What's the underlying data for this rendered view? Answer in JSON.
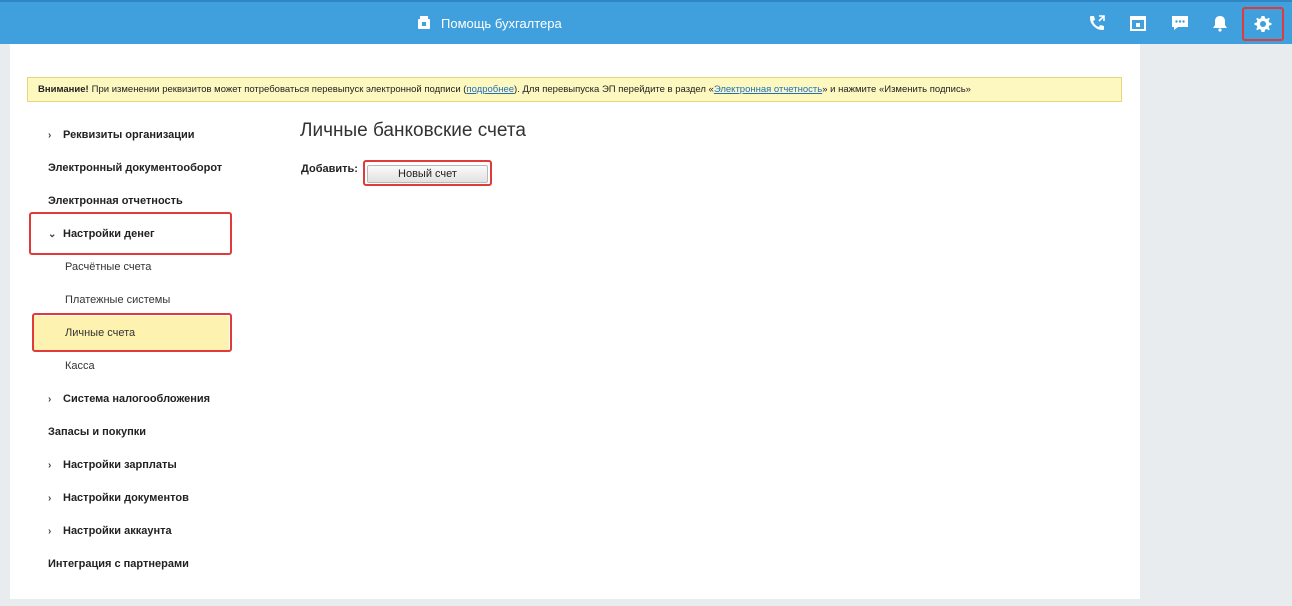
{
  "header": {
    "title": "Помощь бухгалтера",
    "icons": [
      "phone-icon",
      "calendar-icon",
      "chat-icon",
      "bell-icon",
      "gear-icon"
    ]
  },
  "notice": {
    "bold": "Внимание!",
    "text1": "При изменении реквизитов может потребоваться перевыпуск электронной подписи (",
    "link1": "подробнее",
    "text2": "). Для перевыпуска ЭП перейдите в раздел «",
    "link2": "Электронная отчетность",
    "text3": "» и нажмите «Изменить подпись»"
  },
  "sidebar": {
    "items": [
      {
        "label": "Реквизиты организации",
        "arrow": "›"
      },
      {
        "label": "Электронный документооборот"
      },
      {
        "label": "Электронная отчетность"
      },
      {
        "label": "Настройки денег",
        "arrow": "⌄"
      },
      {
        "label": "Расчётные счета"
      },
      {
        "label": "Платежные системы"
      },
      {
        "label": "Личные счета"
      },
      {
        "label": "Касса"
      },
      {
        "label": "Система налогообложения",
        "arrow": "›"
      },
      {
        "label": "Запасы и покупки"
      },
      {
        "label": "Настройки зарплаты",
        "arrow": "›"
      },
      {
        "label": "Настройки документов",
        "arrow": "›"
      },
      {
        "label": "Настройки аккаунта",
        "arrow": "›"
      },
      {
        "label": "Интеграция с партнерами"
      }
    ]
  },
  "main": {
    "title": "Личные банковские счета",
    "add_label": "Добавить:",
    "new_button": "Новый счет"
  },
  "colors": {
    "topbar": "#3fa0dd",
    "highlight": "#e03a3a",
    "selected": "#fdf2b0",
    "notice_bg": "#fdf7c0"
  }
}
